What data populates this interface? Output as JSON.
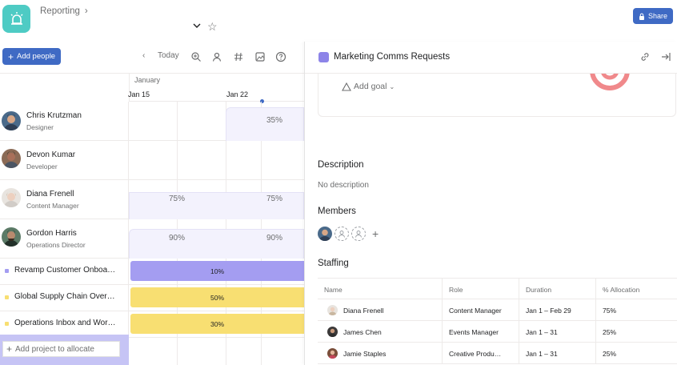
{
  "header": {
    "breadcrumb": "Reporting",
    "share_label": "Share",
    "app_icon": "alarm-icon",
    "accent": "#3f6ac4"
  },
  "toolbar": {
    "add_people_label": "Add people",
    "today_label": "Today"
  },
  "timeline": {
    "month": "January",
    "weeks": [
      "Jan 15",
      "Jan 22"
    ]
  },
  "people": [
    {
      "name": "Chris Krutzman",
      "role": "Designer",
      "allocations": [
        "35%"
      ]
    },
    {
      "name": "Devon Kumar",
      "role": "Developer",
      "allocations": []
    },
    {
      "name": "Diana Frenell",
      "role": "Content Manager",
      "allocations": [
        "75%",
        "75%"
      ]
    },
    {
      "name": "Gordon Harris",
      "role": "Operations Director",
      "allocations": [
        "90%",
        "90%"
      ]
    }
  ],
  "projects": [
    {
      "name": "Revamp Customer Onboa…",
      "allocation": "10%",
      "color": "#a49df1"
    },
    {
      "name": "Global Supply Chain Over…",
      "allocation": "50%",
      "color": "#f8df72"
    },
    {
      "name": "Operations Inbox and Wor…",
      "allocation": "30%",
      "color": "#f8df72"
    }
  ],
  "add_project_placeholder": "Add project to allocate",
  "panel": {
    "title": "Marketing Comms Requests",
    "add_goal_label": "Add goal",
    "description_title": "Description",
    "description_text": "No description",
    "members_title": "Members",
    "staffing_title": "Staffing",
    "staffing": {
      "columns": [
        "Name",
        "Role",
        "Duration",
        "% Allocation"
      ],
      "rows": [
        {
          "name": "Diana Frenell",
          "role": "Content Manager",
          "duration": "Jan 1 – Feb 29",
          "allocation": "75%"
        },
        {
          "name": "James Chen",
          "role": "Events Manager",
          "duration": "Jan 1 – 31",
          "allocation": "25%"
        },
        {
          "name": "Jamie Staples",
          "role": "Creative Produ…",
          "duration": "Jan 1 – 31",
          "allocation": "25%"
        }
      ]
    }
  }
}
